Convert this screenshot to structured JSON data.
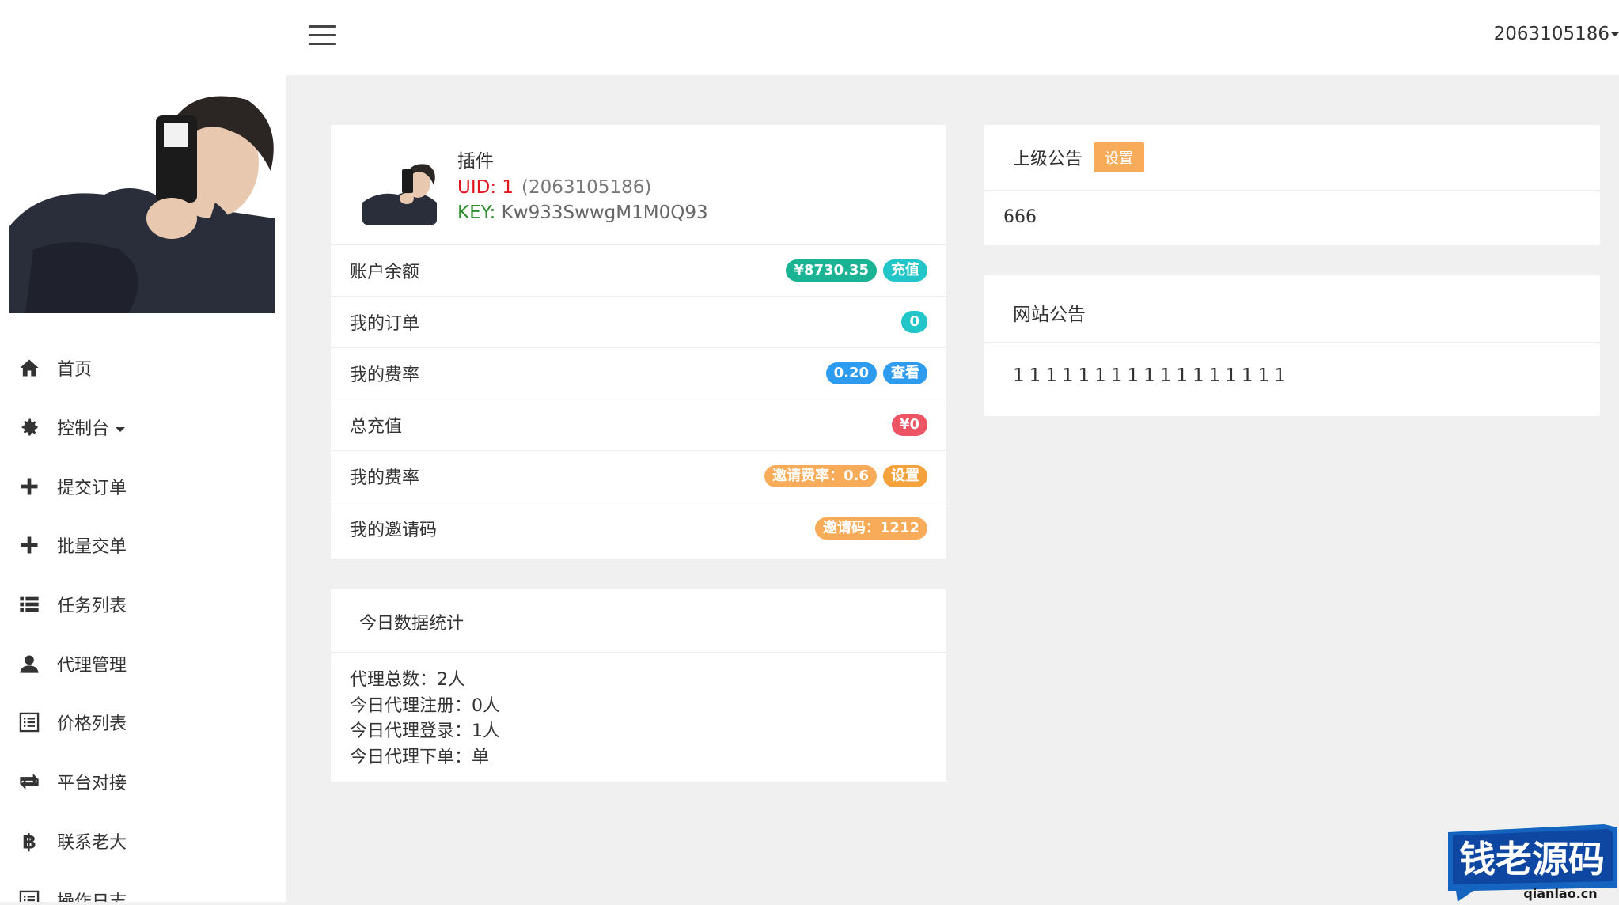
{
  "sidebar": {
    "items": [
      {
        "label": "首页",
        "icon": "home-icon"
      },
      {
        "label": "控制台",
        "icon": "gear-icon",
        "dropdown": true
      },
      {
        "label": "提交订单",
        "icon": "plus-icon"
      },
      {
        "label": "批量交单",
        "icon": "plus-icon"
      },
      {
        "label": "任务列表",
        "icon": "list-icon"
      },
      {
        "label": "代理管理",
        "icon": "user-icon"
      },
      {
        "label": "价格列表",
        "icon": "list-alt-icon"
      },
      {
        "label": "平台对接",
        "icon": "retweet-icon"
      },
      {
        "label": "联系老大",
        "icon": "bitcoin-icon"
      },
      {
        "label": "操作日志",
        "icon": "list-alt-icon"
      }
    ]
  },
  "topbar": {
    "user": "2063105186"
  },
  "profile": {
    "name": "插件",
    "uid_label": "UID: 1",
    "uid_qq": "(2063105186)",
    "key_label": "KEY:",
    "key_value": "Kw933SwwgM1M0Q93"
  },
  "rows": [
    {
      "label": "账户余额",
      "badges": [
        {
          "text": "¥8730.35",
          "color": "green"
        },
        {
          "text": "充值",
          "color": "teal"
        }
      ]
    },
    {
      "label": "我的订单",
      "badges": [
        {
          "text": "0",
          "color": "teal"
        }
      ]
    },
    {
      "label": "我的费率",
      "badges": [
        {
          "text": "0.20",
          "color": "blue"
        },
        {
          "text": "查看",
          "color": "blue"
        }
      ]
    },
    {
      "label": "总充值",
      "badges": [
        {
          "text": "¥0",
          "color": "red"
        }
      ]
    },
    {
      "label": "我的费率",
      "badges": [
        {
          "text": "邀请费率：0.6",
          "color": "orange"
        },
        {
          "text": "设置",
          "color": "orange"
        }
      ]
    },
    {
      "label": "我的邀请码",
      "badges": [
        {
          "text": "邀请码：1212",
          "color": "orange"
        }
      ]
    }
  ],
  "stats": {
    "title": "今日数据统计",
    "lines": [
      "代理总数：2人",
      "今日代理注册：0人",
      "今日代理登录：1人",
      "今日代理下单：单"
    ]
  },
  "notice_parent": {
    "title": "上级公告",
    "button": "设置",
    "content": "666"
  },
  "notice_site": {
    "title": "网站公告",
    "content": "11111111111111111"
  },
  "watermark": {
    "brand": "钱老源码",
    "url": "qianlao.cn"
  }
}
